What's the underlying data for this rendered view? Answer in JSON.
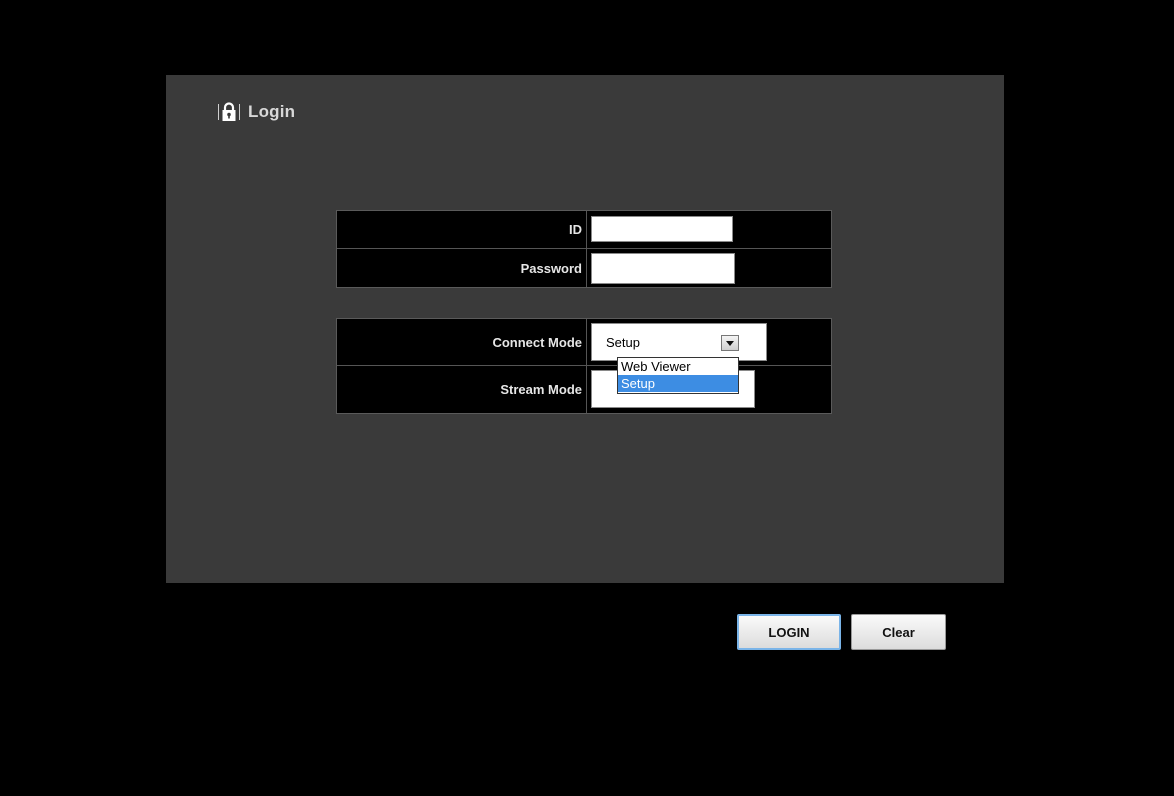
{
  "panel": {
    "title": "Login",
    "icon": "lock-icon"
  },
  "credentials": {
    "id_label": "ID",
    "id_value": "",
    "password_label": "Password",
    "password_value": ""
  },
  "modes": {
    "connect_label": "Connect Mode",
    "connect_selected": "Setup",
    "connect_options": [
      "Web Viewer",
      "Setup"
    ],
    "stream_label": "Stream Mode"
  },
  "buttons": {
    "login_label": "LOGIN",
    "clear_label": "Clear"
  },
  "colors": {
    "page_background": "#000000",
    "panel_background": "#3a3a3a",
    "selected_option": "#3d8de3"
  }
}
